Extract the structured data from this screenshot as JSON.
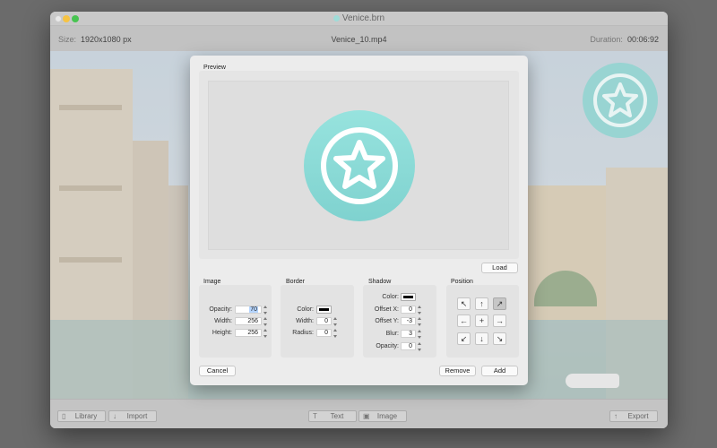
{
  "window": {
    "title": "Venice.brn"
  },
  "infobar": {
    "size_label": "Size:",
    "size_value": "1920x1080 px",
    "filename": "Venice_10.mp4",
    "duration_label": "Duration:",
    "duration_value": "00:06:92"
  },
  "toolbar": {
    "library": "Library",
    "import": "Import",
    "text": "Text",
    "image": "Image",
    "export": "Export"
  },
  "dialog": {
    "preview_label": "Preview",
    "load_button": "Load",
    "image": {
      "label": "Image",
      "opacity_label": "Opacity:",
      "opacity_value": "70",
      "width_label": "Width:",
      "width_value": "256",
      "height_label": "Height:",
      "height_value": "256"
    },
    "border": {
      "label": "Border",
      "color_label": "Color:",
      "color": "#000000",
      "width_label": "Width:",
      "width_value": "0",
      "radius_label": "Radius:",
      "radius_value": "0"
    },
    "shadow": {
      "label": "Shadow",
      "color_label": "Color:",
      "color": "#000000",
      "offset_x_label": "Offset X:",
      "offset_x_value": "0",
      "offset_y_label": "Offset Y:",
      "offset_y_value": "-3",
      "blur_label": "Blur:",
      "blur_value": "3",
      "opacity_label": "Opacity:",
      "opacity_value": "0"
    },
    "position": {
      "label": "Position",
      "selected": "top-right",
      "grid": [
        "↖",
        "↑",
        "↗",
        "←",
        "+",
        "→",
        "↙",
        "↓",
        "↘"
      ]
    },
    "cancel_button": "Cancel",
    "remove_button": "Remove",
    "add_button": "Add"
  },
  "icon": {
    "name": "star-badge-icon",
    "color": "#8fdcd7"
  }
}
